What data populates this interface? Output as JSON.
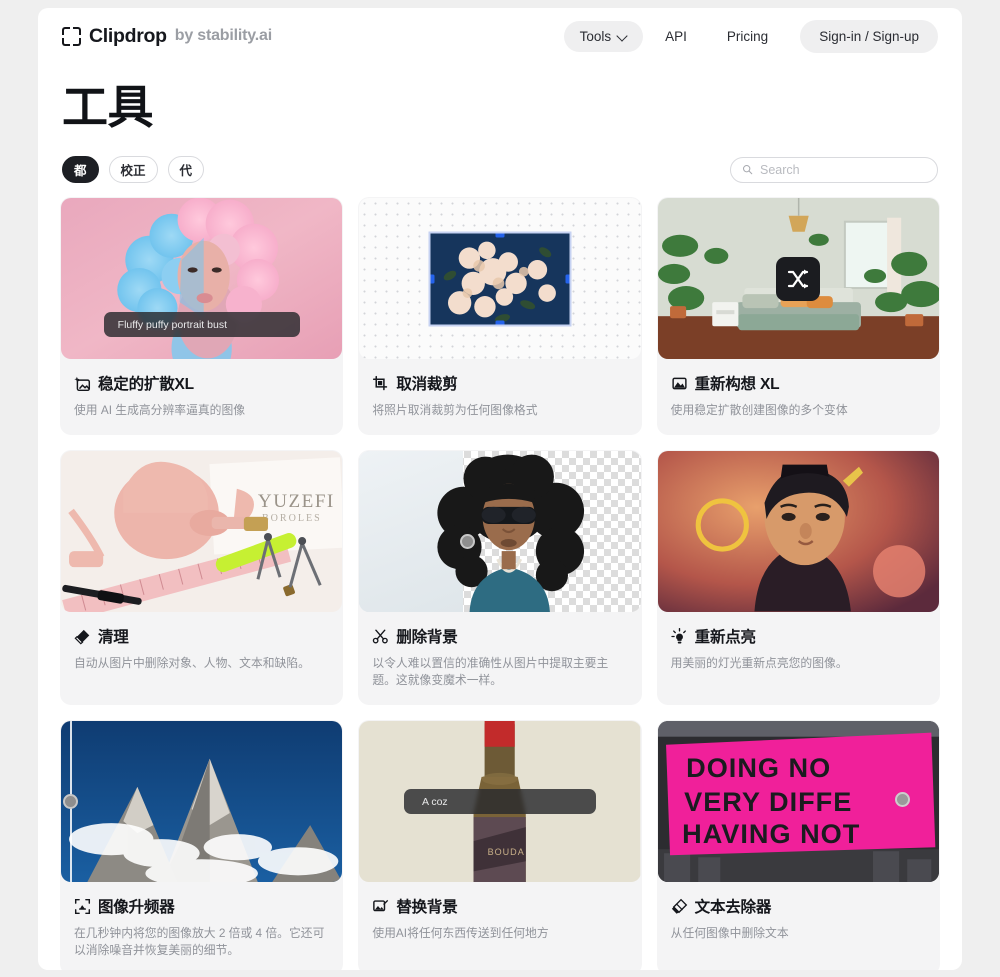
{
  "header": {
    "brand_name": "Clipdrop",
    "brand_by": "by stability.ai",
    "nav": {
      "tools_label": "Tools",
      "api_label": "API",
      "pricing_label": "Pricing",
      "auth_label": "Sign-in / Sign-up"
    }
  },
  "page": {
    "title": "工具",
    "filters": [
      {
        "label": "都",
        "active": true
      },
      {
        "label": "校正",
        "active": false
      },
      {
        "label": "代",
        "active": false
      }
    ],
    "search": {
      "placeholder": "Search",
      "value": ""
    }
  },
  "cards": [
    {
      "icon": "image-sparkle-icon",
      "title": "稳定的扩散XL",
      "desc": "使用 AI 生成高分辨率逼真的图像",
      "media": "prompt-portrait",
      "prompt": "Fluffy puffy portrait bust"
    },
    {
      "icon": "uncrop-icon",
      "title": "取消裁剪",
      "desc": "将照片取消裁剪为任何图像格式",
      "media": "uncrop-canvas",
      "prompt": ""
    },
    {
      "icon": "mountain-icon",
      "title": "重新构想 XL",
      "desc": "使用稳定扩散创建图像的多个变体",
      "media": "bedroom-shuffle",
      "prompt": ""
    },
    {
      "icon": "eraser-icon",
      "title": "清理",
      "desc": "自动从图片中删除对象、人物、文本和缺陷。",
      "media": "desk-pink",
      "prompt": ""
    },
    {
      "icon": "cutout-icon",
      "title": "删除背景",
      "desc": "以令人难以置信的准确性从图片中提取主要主题。这就像变魔术一样。",
      "media": "cutout-man",
      "prompt": ""
    },
    {
      "icon": "relight-icon",
      "title": "重新点亮",
      "desc": "用美丽的灯光重新点亮您的图像。",
      "media": "relight-portrait",
      "prompt": ""
    },
    {
      "icon": "upscale-icon",
      "title": "图像升频器",
      "desc": "在几秒钟内将您的图像放大 2 倍或 4 倍。它还可以消除噪音并恢复美丽的细节。",
      "media": "mountain-slider",
      "prompt": ""
    },
    {
      "icon": "replace-bg-icon",
      "title": "替换背景",
      "desc": "使用AI将任何东西传送到任何地方",
      "media": "wine-prompt",
      "prompt": "A coz"
    },
    {
      "icon": "text-remover-icon",
      "title": "文本去除器",
      "desc": "从任何图像中删除文本",
      "media": "billboard",
      "prompt": ""
    }
  ],
  "billboard_text": {
    "line1": "DOING NO",
    "line2": "VERY DIFFE",
    "line3": "HAVING NOT"
  },
  "colors": {
    "accent_blue": "#2563eb",
    "dark": "#1d1f24",
    "card_bg": "#f4f4f5",
    "muted_text": "#90939a"
  }
}
